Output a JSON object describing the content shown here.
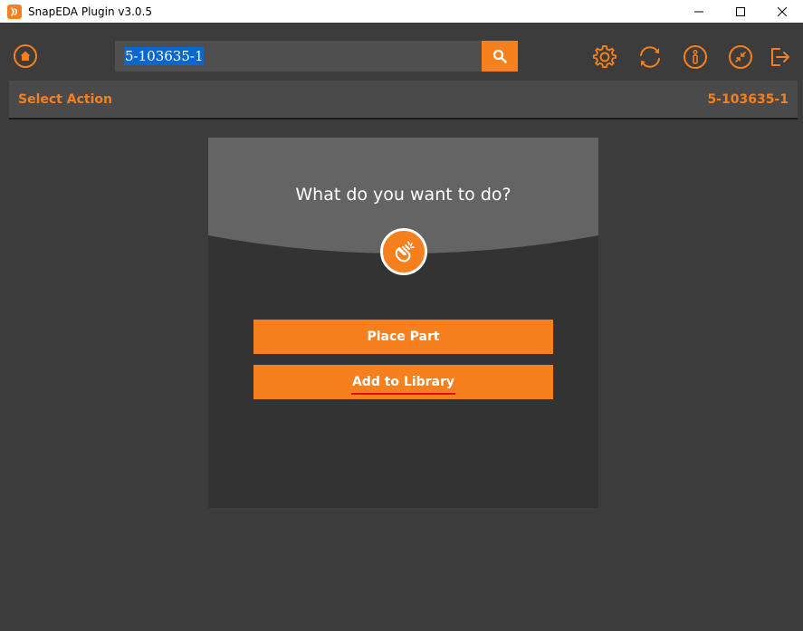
{
  "window": {
    "title": "SnapEDA Plugin v3.0.5",
    "controls": [
      "minimize",
      "maximize",
      "close"
    ]
  },
  "toolbar": {
    "search_value": "5-103635-1",
    "icons": [
      "home-icon",
      "search-icon",
      "gear-icon",
      "refresh-icon",
      "info-icon",
      "collapse-icon",
      "logout-icon"
    ]
  },
  "header": {
    "title": "Select Action",
    "part_number": "5-103635-1"
  },
  "dialog": {
    "question": "What do you want to do?",
    "buttons": {
      "place_part": "Place Part",
      "add_to_library": "Add to Library"
    }
  },
  "colors": {
    "accent": "#f7801e",
    "background": "#3c3c3c",
    "card": "#333333",
    "card_header": "#646464",
    "selection": "#0b67d0",
    "annotation": "#e0101a"
  }
}
